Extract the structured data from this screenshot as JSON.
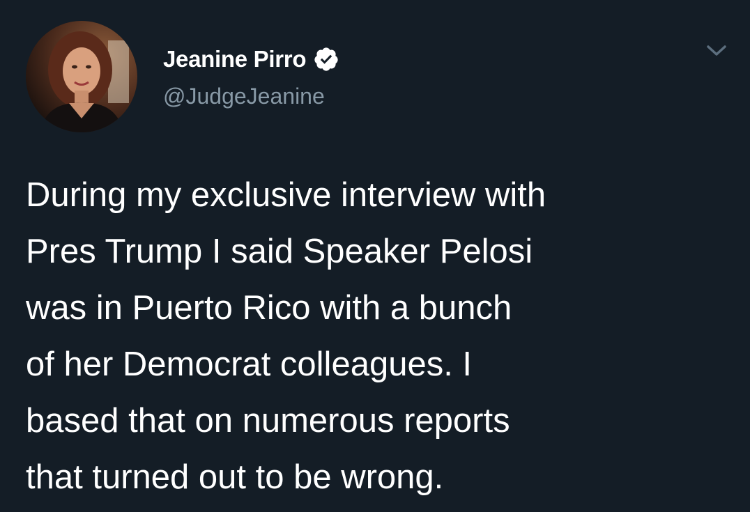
{
  "tweet": {
    "author": {
      "display_name": "Jeanine Pirro",
      "handle": "@JudgeJeanine",
      "verified": true,
      "avatar_icon": "profile-photo"
    },
    "menu_icon": "chevron-down-icon",
    "text": "During my exclusive interview with\nPres Trump I said Speaker Pelosi\nwas in Puerto Rico with a bunch\nof her Democrat colleagues. I\nbased that on numerous reports\nthat turned out to be wrong."
  },
  "colors": {
    "background": "#141d26",
    "primary_text": "#ffffff",
    "secondary_text": "#8899a6",
    "verified_badge": "#ffffff"
  }
}
